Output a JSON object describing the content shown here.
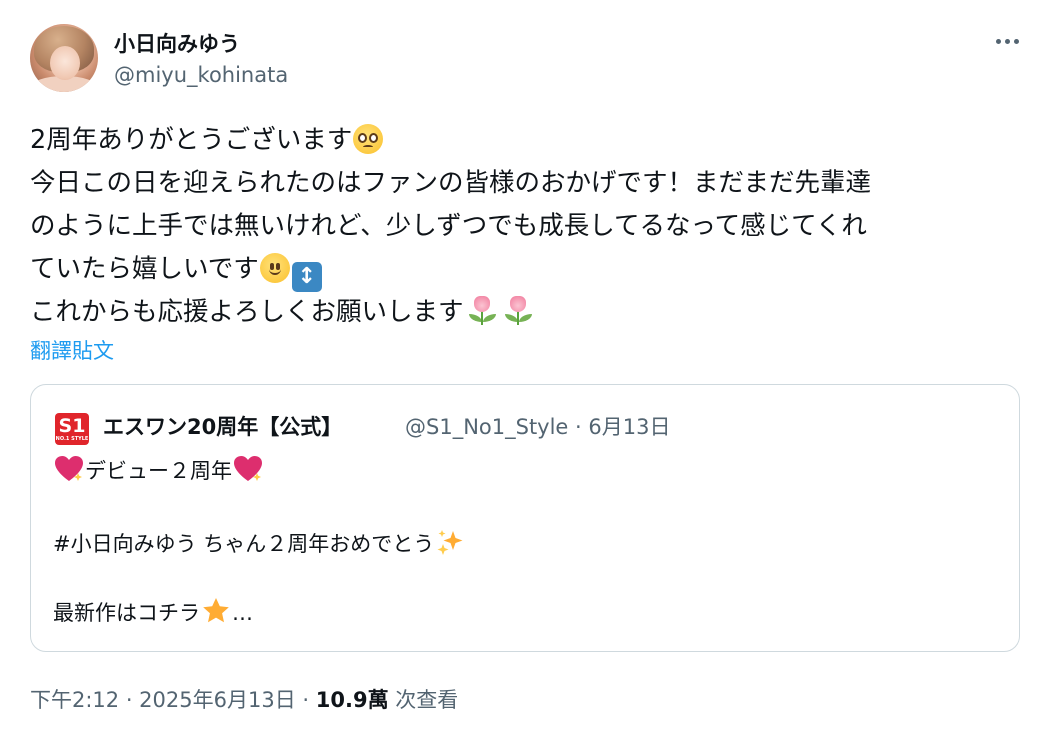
{
  "author": {
    "display_name": "小日向みゆう",
    "handle": "@miyu_kohinata"
  },
  "tweet": {
    "line1": "2周年ありがとうございます",
    "line2": "今日この日を迎えられたのはファンの皆様のおかげです！まだまだ先輩達",
    "line3": "のように上手では無いけれど、少しずつでも成長してるなって感じてくれ",
    "line4": "ていたら嬉しいです",
    "line5": "これからも応援よろしくお願いします",
    "emoji": {
      "line1_end": "pleading-face-emoji",
      "line4_end": [
        "slightly-smiling-face-emoji",
        "up-down-arrow-emoji"
      ],
      "line5_end": [
        "tulip-emoji",
        "tulip-emoji"
      ]
    },
    "translate_label": "翻譯貼文"
  },
  "quoted": {
    "avatar_text": "S1",
    "avatar_subtext": "NO.1 STYLE",
    "name": "エスワン20周年【公式】",
    "meta": "@S1_No1_Style · 6月13日",
    "line1": "デビュー２周年",
    "line2": "#小日向みゆう ちゃん２周年おめでとう",
    "line3": "最新作はコチラ",
    "line3_suffix": "…",
    "emoji": {
      "line1": [
        "sparkling-heart-emoji",
        "sparkling-heart-emoji"
      ],
      "line2_end": "sparkles-emoji",
      "line3_end": "star-emoji"
    }
  },
  "footer": {
    "time": "下午2:12 · 2025年6月13日",
    "separator": " · ",
    "views_count": "10.9萬",
    "views_label": " 次查看"
  },
  "colors": {
    "link": "#1d9bf0",
    "secondary_text": "#536471",
    "border": "#cfd9de",
    "quoted_brand": "#e0252b"
  }
}
